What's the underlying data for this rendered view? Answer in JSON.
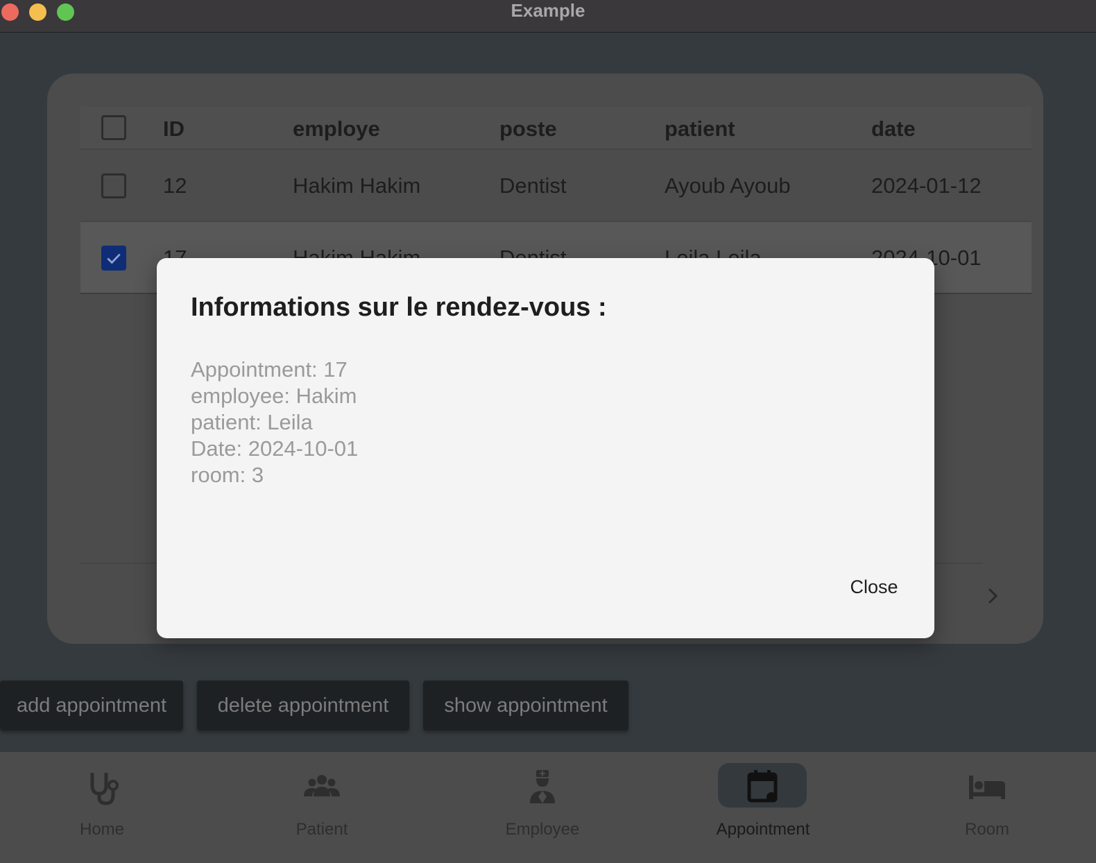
{
  "window": {
    "title": "Example"
  },
  "table": {
    "headers": {
      "id": "ID",
      "employe": "employe",
      "poste": "poste",
      "patient": "patient",
      "date": "date"
    },
    "rows": [
      {
        "id": "12",
        "employe": "Hakim Hakim",
        "poste": "Dentist",
        "patient": "Ayoub Ayoub",
        "date": "2024-01-12",
        "selected": false
      },
      {
        "id": "17",
        "employe": "Hakim Hakim",
        "poste": "Dentist",
        "patient": "Leila Leila",
        "date": "2024-10-01",
        "selected": true
      }
    ]
  },
  "actions": {
    "add": "add appointment",
    "delete": "delete appointment",
    "show": "show appointment"
  },
  "nav": {
    "items": [
      {
        "label": "Home",
        "icon": "stethoscope-icon"
      },
      {
        "label": "Patient",
        "icon": "group-icon"
      },
      {
        "label": "Employee",
        "icon": "medical-staff-icon"
      },
      {
        "label": "Appointment",
        "icon": "calendar-icon",
        "active": true
      },
      {
        "label": "Room",
        "icon": "bed-icon"
      }
    ]
  },
  "dialog": {
    "title": "Informations sur le rendez-vous :",
    "lines": [
      "Appointment: 17",
      "employee: Hakim",
      "patient: Leila",
      "Date: 2024-10-01",
      "room: 3"
    ],
    "close_label": "Close"
  },
  "colors": {
    "accent_checkbox": "#0f2c77",
    "active_nav_pill": "#33393d",
    "dialog_bg": "#f4f4f4"
  }
}
